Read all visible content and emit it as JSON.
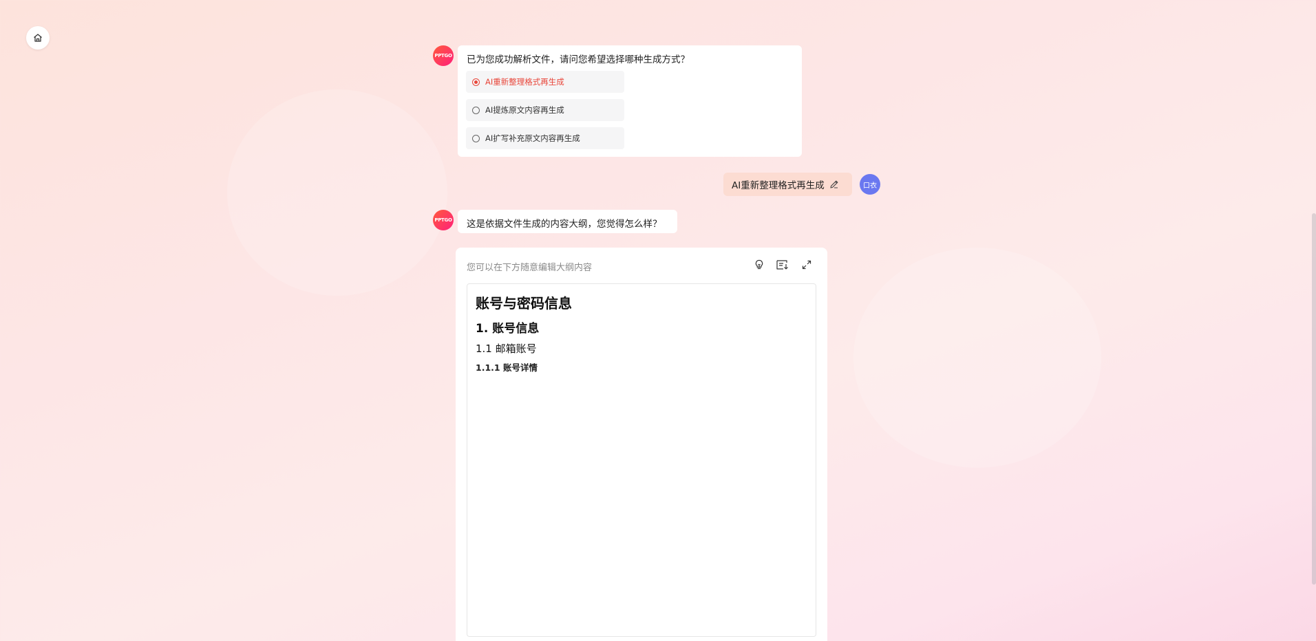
{
  "home": {
    "icon": "home-icon"
  },
  "bot": {
    "avatar_label": "PPTGO"
  },
  "user": {
    "avatar_label": "口衣"
  },
  "messages": {
    "choice_question": "已为您成功解析文件，请问您希望选择哪种生成方式？",
    "options": [
      {
        "label": "AI重新整理格式再生成",
        "selected": true
      },
      {
        "label": "AI提炼原文内容再生成",
        "selected": false
      },
      {
        "label": "AI扩写补充原文内容再生成",
        "selected": false
      }
    ],
    "user_reply": "AI重新整理格式再生成",
    "outline_intro": "这是依据文件生成的内容大纲，您觉得怎么样？"
  },
  "outline": {
    "hint": "您可以在下方随意编辑大纲内容",
    "toolbar": [
      "lightbulb-icon",
      "list-download-icon",
      "expand-icon"
    ],
    "content": {
      "title": "账号与密码信息",
      "section": "1. 账号信息",
      "subsection": "1.1 邮箱账号",
      "subsubsection": "1.1.1 账号详情"
    }
  },
  "colors": {
    "accent": "#e8463a",
    "user_bubble": "#fcdcd2",
    "user_avatar": "#6a78f0"
  }
}
